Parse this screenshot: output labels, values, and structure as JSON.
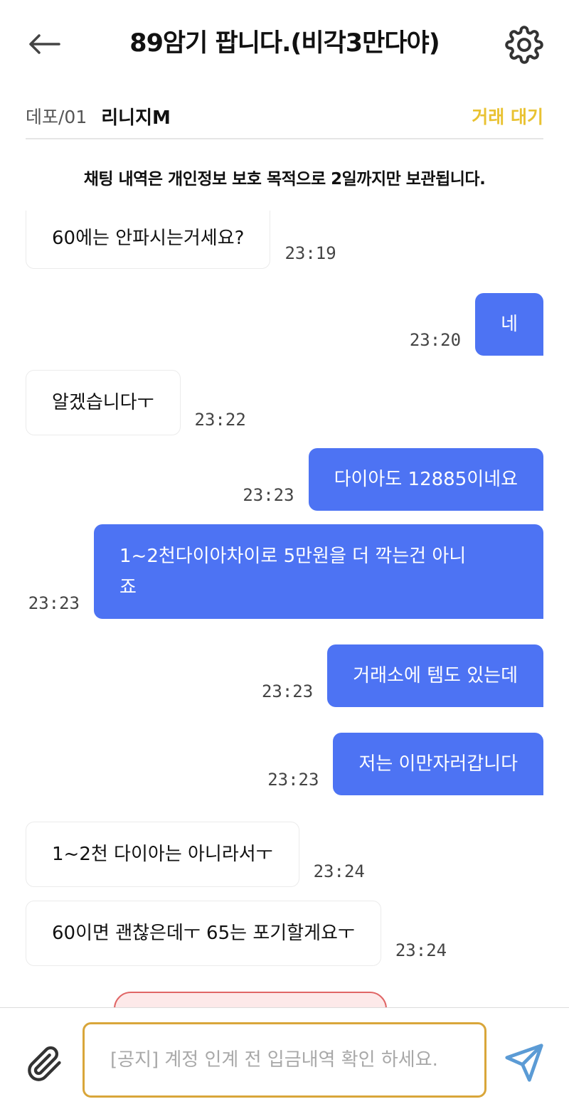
{
  "header": {
    "title": "89암기 팝니다.(비각3만다야)",
    "back_icon": "arrow-left-icon",
    "settings_icon": "gear-icon"
  },
  "info": {
    "server": "데포/01",
    "game": "리니지M",
    "status": "거래 대기",
    "status_color": "#e9c232"
  },
  "notice": "채팅 내역은 개인정보 보호 목적으로 2일까지만 보관됩니다.",
  "messages": [
    {
      "side": "in",
      "text": "60에는 안파시는거세요?",
      "time": "23:19"
    },
    {
      "side": "out",
      "text": "네",
      "time": "23:20"
    },
    {
      "side": "in",
      "text": "알겠습니다ㅜ",
      "time": "23:22"
    },
    {
      "side": "out",
      "text": "다이아도 12885이네요",
      "time": "23:23"
    },
    {
      "side": "out",
      "text_line1": "1~2천다이아차이로 5만원을 더 깍는건 아니",
      "text_line2": "죠",
      "time": "23:23"
    },
    {
      "side": "out",
      "text": "거래소에 템도 있는데",
      "time": "23:23"
    },
    {
      "side": "out",
      "text": "저는 이만자러갑니다",
      "time": "23:23"
    },
    {
      "side": "in",
      "text": "1~2천 다이아는 아니라서ㅜ",
      "time": "23:24"
    },
    {
      "side": "in",
      "text": "60이면 괜찮은데ㅜ 65는 포기할게요ㅜ",
      "time": "23:24"
    }
  ],
  "composer": {
    "placeholder": "[공지] 계정 인계 전 입금내역 확인 하세요.",
    "value": "",
    "attach_icon": "paperclip-icon",
    "send_icon": "paper-plane-icon"
  },
  "colors": {
    "outgoing_bubble": "#4d73f3",
    "input_border": "#d9a63a",
    "send_icon": "#5b9bd5"
  }
}
